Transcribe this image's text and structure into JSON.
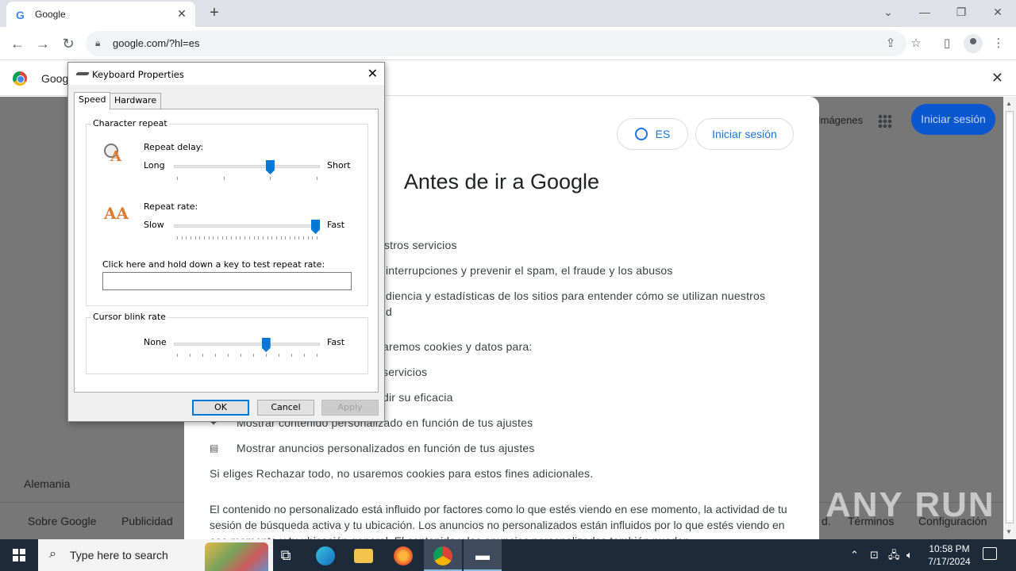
{
  "browser": {
    "tab_title": "Google",
    "tab_icon": "G",
    "new_tab": "+",
    "url": "google.com/?hl=es",
    "infobar_text": "Goog"
  },
  "page": {
    "bg_images_link": "Imágenes",
    "bg_signin": "Iniciar sesión",
    "country": "Alemania",
    "footer_links": [
      "Sobre Google",
      "Publicidad",
      "d.",
      "Términos",
      "Configuración"
    ],
    "consent": {
      "lang_button": "ES",
      "signin_button": "Iniciar sesión",
      "title": "Antes de ir a Google",
      "lines": [
        "estros servicios",
        "interrupciones y prevenir el spam, el fraude y los abusos",
        "diencia y estadísticas de los sitios para entender cómo se utilizan nuestros",
        "d",
        "aremos cookies y datos para:",
        "servicios",
        "dir su eficacia",
        "Mostrar contenido personalizado en función de tus ajustes",
        "Mostrar anuncios personalizados en función de tus ajustes",
        "Si eliges Rechazar todo, no usaremos cookies para estos fines adicionales."
      ],
      "paragraph": "El contenido no personalizado está influido por factores como lo que estés viendo en ese momento, la actividad de tu sesión de búsqueda activa y tu ubicación. Los anuncios no personalizados están influidos por lo que estés viendo en ese momento y tu ubicación general. El contenido y los anuncios personalizados también pueden"
    },
    "watermark": "ANY RUN"
  },
  "dialog": {
    "title": "Keyboard Properties",
    "tabs": [
      "Speed",
      "Hardware"
    ],
    "active_tab": "Speed",
    "character_repeat": {
      "group_label": "Character repeat",
      "repeat_delay": {
        "label": "Repeat delay:",
        "min_label": "Long",
        "max_label": "Short",
        "value": 0.67
      },
      "repeat_rate": {
        "label": "Repeat rate:",
        "min_label": "Slow",
        "max_label": "Fast",
        "value": 1.0
      },
      "test_prompt": "Click here and hold down a key to test repeat rate:",
      "test_value": ""
    },
    "cursor_blink": {
      "group_label": "Cursor blink rate",
      "min_label": "None",
      "max_label": "Fast",
      "value": 0.64
    },
    "buttons": {
      "ok": "OK",
      "cancel": "Cancel",
      "apply": "Apply"
    }
  },
  "taskbar": {
    "search_placeholder": "Type here to search",
    "time": "10:58 PM",
    "date": "7/17/2024"
  }
}
